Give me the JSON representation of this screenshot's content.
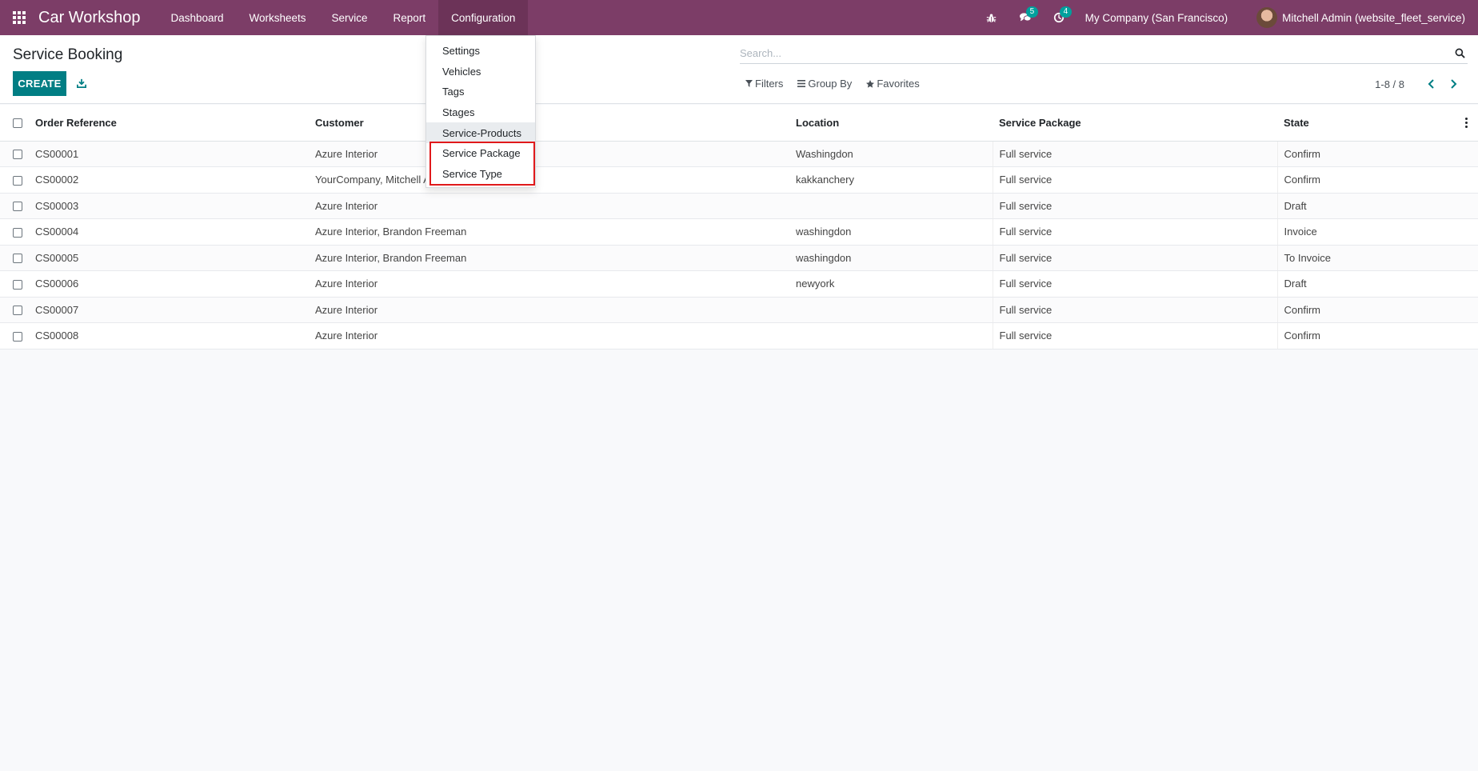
{
  "app": {
    "title": "Car Workshop",
    "menu": [
      "Dashboard",
      "Worksheets",
      "Service",
      "Report",
      "Configuration"
    ],
    "active_menu": "Configuration"
  },
  "systray": {
    "messages_count": "5",
    "activities_count": "4",
    "company": "My Company (San Francisco)",
    "user": "Mitchell Admin (website_fleet_service)"
  },
  "page": {
    "title": "Service Booking",
    "create_label": "CREATE"
  },
  "search": {
    "placeholder": "Search..."
  },
  "filters": {
    "filters_label": "Filters",
    "group_by_label": "Group By",
    "favorites_label": "Favorites"
  },
  "pager": {
    "value": "1-8 / 8"
  },
  "table": {
    "columns": [
      "Order Reference",
      "Customer",
      "Location",
      "Service Package",
      "State"
    ],
    "rows": [
      [
        "CS00001",
        "Azure Interior",
        "Washingdon",
        "Full service",
        "Confirm"
      ],
      [
        "CS00002",
        "YourCompany, Mitchell Admin",
        "kakkanchery",
        "Full service",
        "Confirm"
      ],
      [
        "CS00003",
        "Azure Interior",
        "",
        "Full service",
        "Draft"
      ],
      [
        "CS00004",
        "Azure Interior, Brandon Freeman",
        "washingdon",
        "Full service",
        "Invoice"
      ],
      [
        "CS00005",
        "Azure Interior, Brandon Freeman",
        "washingdon",
        "Full service",
        "To Invoice"
      ],
      [
        "CS00006",
        "Azure Interior",
        "newyork",
        "Full service",
        "Draft"
      ],
      [
        "CS00007",
        "Azure Interior",
        "",
        "Full service",
        "Confirm"
      ],
      [
        "CS00008",
        "Azure Interior",
        "",
        "Full service",
        "Confirm"
      ]
    ]
  },
  "config_dropdown": {
    "items": [
      "Settings",
      "Vehicles",
      "Tags",
      "Stages",
      "Service-Products",
      "Service Package",
      "Service Type"
    ],
    "hovered": "Service-Products",
    "highlighted": [
      "Service Package",
      "Service Type"
    ]
  },
  "colors": {
    "navbar": "#7c3d67",
    "primary": "#017e84",
    "highlight": "#e0191b"
  }
}
